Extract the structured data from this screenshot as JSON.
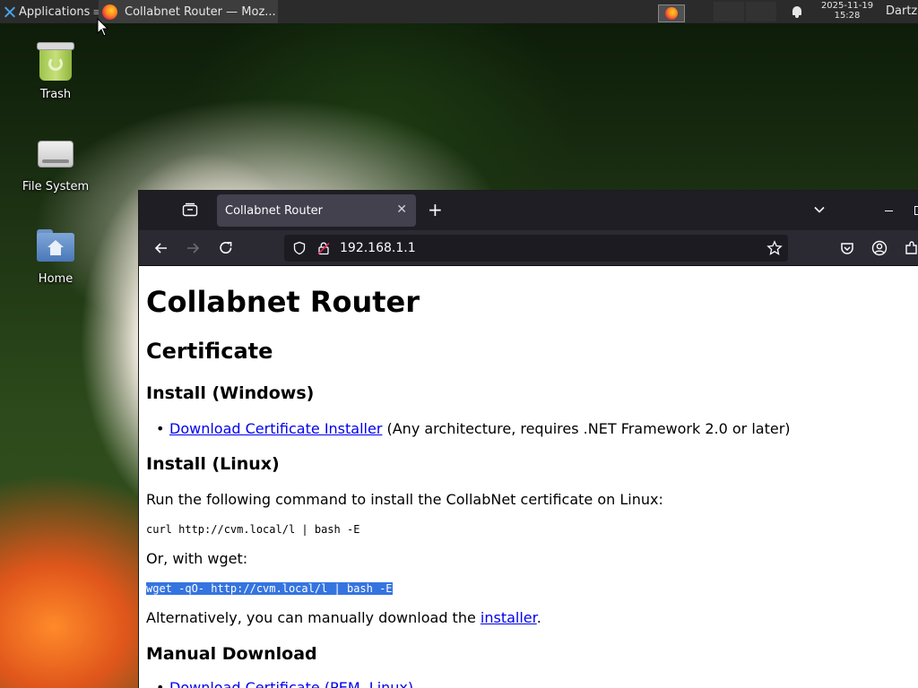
{
  "panel": {
    "applications_label": "Applications",
    "task_title": "Collabnet Router — Moz...",
    "clock_date": "2025-11-19",
    "clock_time": "15:28",
    "user": "Dartz"
  },
  "desktop": {
    "icons": [
      {
        "label": "Trash",
        "icon": "trash-icon"
      },
      {
        "label": "File System",
        "icon": "drive-icon"
      },
      {
        "label": "Home",
        "icon": "home-folder-icon"
      }
    ]
  },
  "browser": {
    "tab_title": "Collabnet Router",
    "url": "192.168.1.1",
    "accent": "#3574e0"
  },
  "page": {
    "h1": "Collabnet Router",
    "h2": "Certificate",
    "windows_heading": "Install (Windows)",
    "windows_link": "Download Certificate Installer",
    "windows_note": " (Any architecture, requires .NET Framework 2.0 or later)",
    "linux_heading": "Install (Linux)",
    "linux_intro": "Run the following command to install the CollabNet certificate on Linux:",
    "curl_cmd": "curl http://cvm.local/l | bash -E",
    "wget_intro": "Or, with wget:",
    "wget_cmd": "wget -qO- http://cvm.local/l | bash -E",
    "alt_prefix": "Alternatively, you can manually download the ",
    "alt_link": "installer",
    "alt_suffix": ".",
    "manual_heading": "Manual Download",
    "manual_link": "Download Certificate (PEM, Linux)"
  }
}
